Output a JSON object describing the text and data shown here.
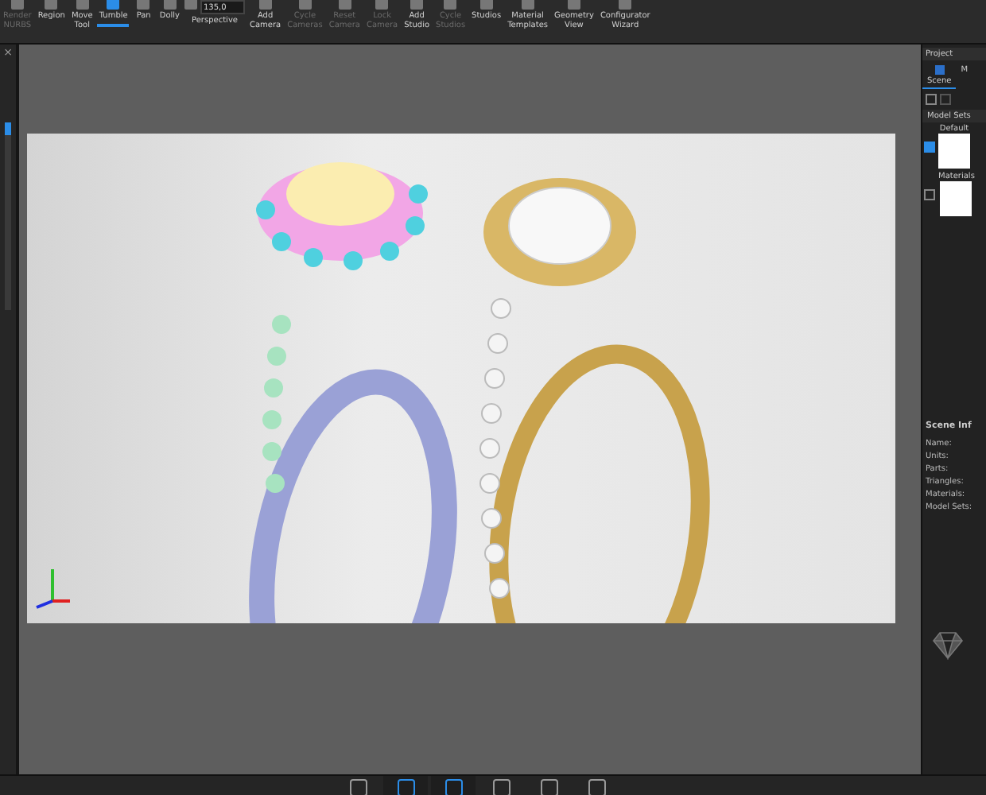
{
  "toolbar": {
    "tools": [
      {
        "kind": "button",
        "label": "Render NURBS",
        "disabled": true,
        "selected": false
      },
      {
        "kind": "button",
        "label": "Region",
        "disabled": false,
        "selected": false
      },
      {
        "kind": "button",
        "label": "Move Tool",
        "disabled": false,
        "selected": false
      },
      {
        "kind": "button",
        "label": "Tumble",
        "disabled": false,
        "selected": true
      },
      {
        "kind": "button",
        "label": "Pan",
        "disabled": false,
        "selected": false
      },
      {
        "kind": "button",
        "label": "Dolly",
        "disabled": false,
        "selected": false
      },
      {
        "kind": "field",
        "label": "Perspective",
        "value": "135,0",
        "disabled": false,
        "selected": false
      },
      {
        "kind": "button",
        "label": "Add Camera",
        "disabled": false,
        "selected": false
      },
      {
        "kind": "button",
        "label": "Cycle Cameras",
        "disabled": true,
        "selected": false
      },
      {
        "kind": "button",
        "label": "Reset Camera",
        "disabled": true,
        "selected": false
      },
      {
        "kind": "button",
        "label": "Lock Camera",
        "disabled": true,
        "selected": false
      },
      {
        "kind": "button",
        "label": "Add Studio",
        "disabled": false,
        "selected": false
      },
      {
        "kind": "button",
        "label": "Cycle Studios",
        "disabled": true,
        "selected": false
      },
      {
        "kind": "button",
        "label": "Studios",
        "disabled": false,
        "selected": false
      },
      {
        "kind": "button",
        "label": "Material Templates",
        "disabled": false,
        "selected": false
      },
      {
        "kind": "button",
        "label": "Geometry View",
        "disabled": false,
        "selected": false
      },
      {
        "kind": "button",
        "label": "Configurator Wizard",
        "disabled": false,
        "selected": false
      }
    ]
  },
  "left_panel": {
    "close": "×"
  },
  "project_panel": {
    "title": "Project",
    "tabs": [
      {
        "label": "Scene",
        "selected": true
      },
      {
        "label": "M",
        "selected": false
      }
    ],
    "model_sets": {
      "header": "Model Sets",
      "items": [
        {
          "name": "Default",
          "checked": true
        },
        {
          "name": "Materials",
          "checked": false
        }
      ]
    },
    "scene_info": {
      "title": "Scene Inf",
      "fields": [
        "Name:",
        "Units:",
        "Parts:",
        "Triangles:",
        "Materials:",
        "Model Sets:"
      ]
    }
  },
  "bottom_bar": {
    "buttons": [
      {
        "selected": false
      },
      {
        "selected": true
      },
      {
        "selected": true
      },
      {
        "selected": false
      },
      {
        "selected": false
      },
      {
        "selected": false
      }
    ]
  }
}
